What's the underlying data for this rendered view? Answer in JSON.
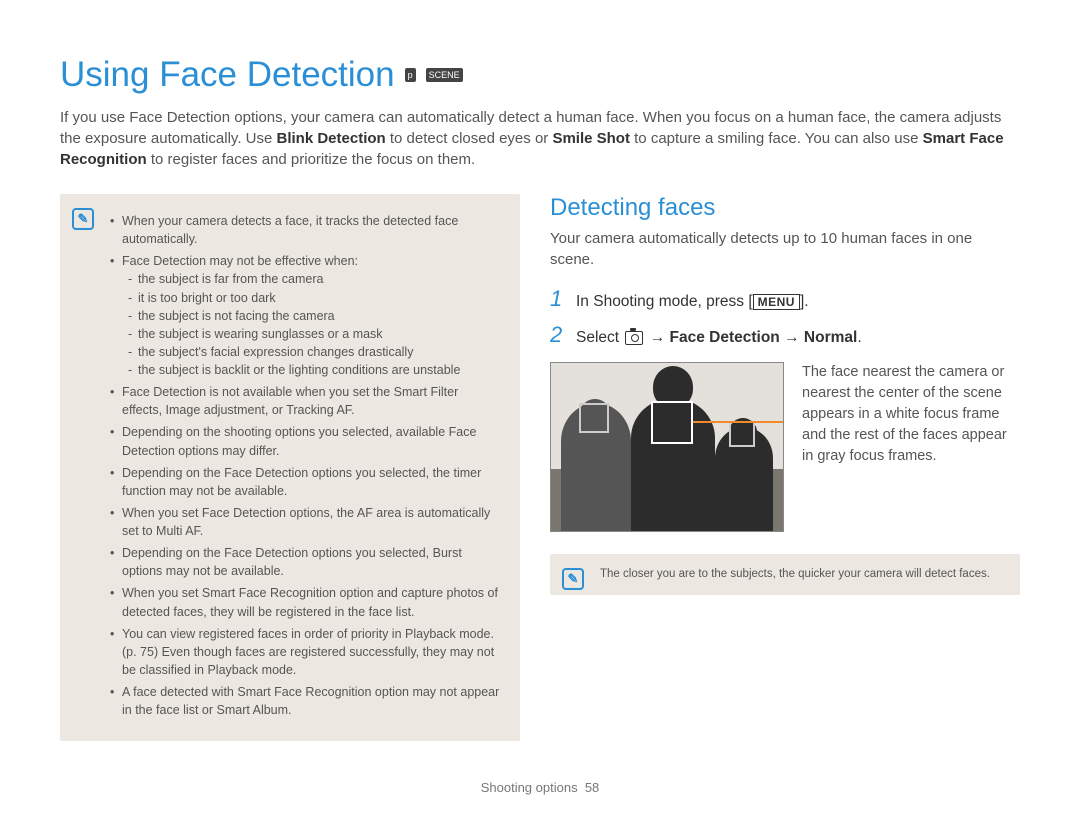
{
  "title": "Using Face Detection",
  "mode_icons": [
    "p",
    "SCENE"
  ],
  "intro": {
    "p1a": "If you use Face Detection options, your camera can automatically detect a human face. When you focus on a human face, the camera adjusts the exposure automatically. Use ",
    "b1": "Blink Detection",
    "p1b": " to detect closed eyes or ",
    "b2": "Smile Shot",
    "p1c": " to capture a smiling face. You can also use ",
    "b3": "Smart Face Recognition",
    "p1d": " to register faces and prioritize the focus on them."
  },
  "notes": {
    "items": [
      "When your camera detects a face, it tracks the detected face automatically.",
      "Face Detection may not be effective when:",
      "Face Detection is not available when you set the Smart Filter effects, Image adjustment, or Tracking AF.",
      "Depending on the shooting options you selected, available Face Detection options may differ.",
      "Depending on the Face Detection options you selected, the timer function may not be available.",
      "When you set Face Detection options, the AF area is automatically set to Multi AF.",
      "Depending on the Face Detection options you selected, Burst options may not be available.",
      "When you set Smart Face Recognition option and capture photos of detected faces, they will be registered in the face list.",
      "You can view registered faces in order of priority in Playback mode. (p. 75) Even though faces are registered successfully, they may not be classified in Playback mode.",
      "A face detected with Smart Face Recognition option may not appear in the face list or Smart Album."
    ],
    "sub": [
      "the subject is far from the camera",
      "it is too bright or too dark",
      "the subject is not facing the camera",
      "the subject is wearing sunglasses or a mask",
      "the subject's facial expression changes drastically",
      "the subject is backlit or the lighting conditions are unstable"
    ]
  },
  "section": {
    "title": "Detecting faces",
    "desc": "Your camera automatically detects up to 10 human faces in one scene.",
    "step1a": "In Shooting mode, press [",
    "step1_menu": "MENU",
    "step1b": "].",
    "step2a": "Select ",
    "step2_arrow1": " → ",
    "step2_b1": "Face Detection",
    "step2_arrow2": " → ",
    "step2_b2": "Normal",
    "step2_end": ".",
    "caption": "The face nearest the camera or nearest the center of the scene appears in a white focus frame and the rest of the faces appear in gray focus frames.",
    "tip": "The closer you are to the subjects, the quicker your camera will detect faces."
  },
  "footer": {
    "section": "Shooting options",
    "page": "58"
  }
}
